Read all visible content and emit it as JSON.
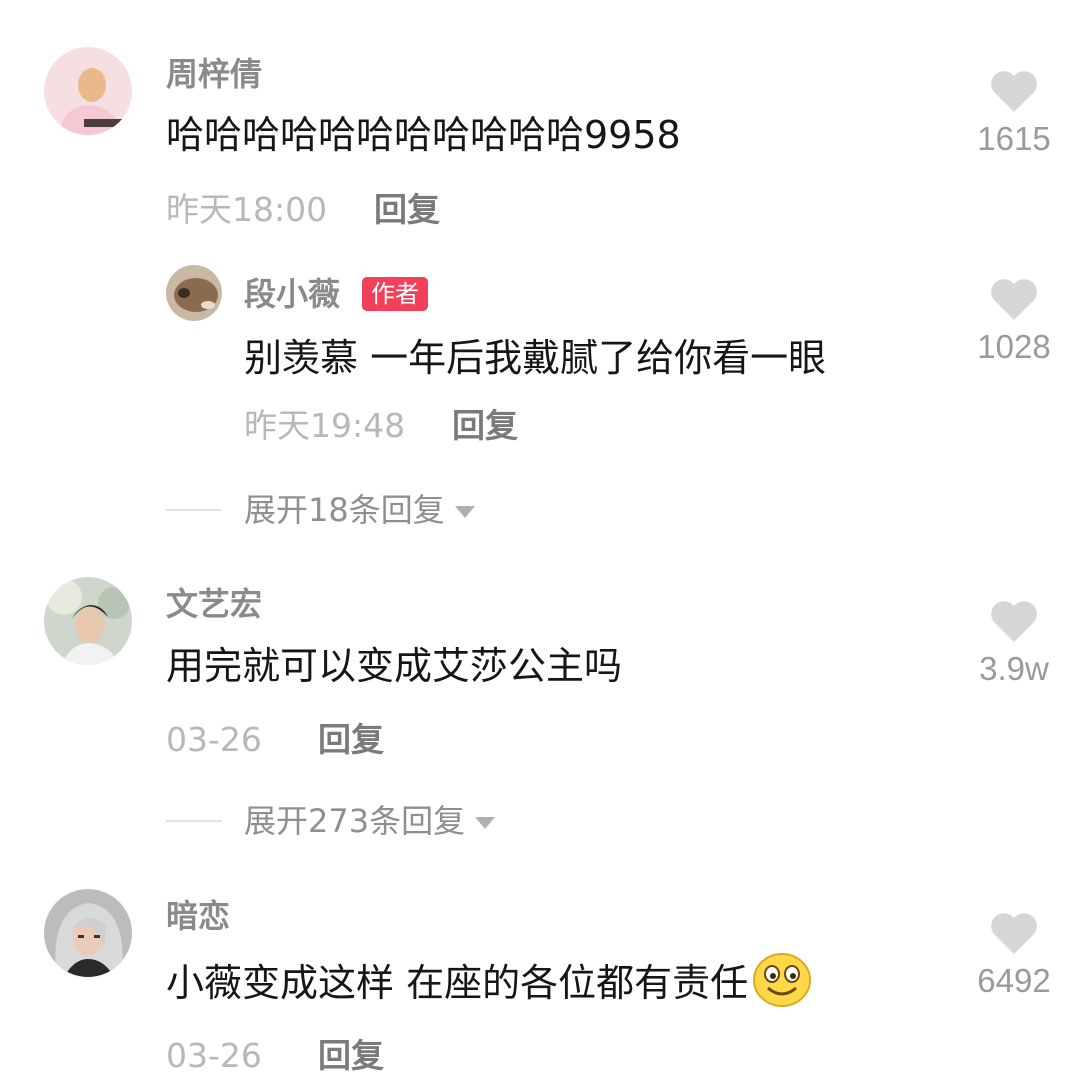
{
  "comments": [
    {
      "user": "周梓倩",
      "text": "哈哈哈哈哈哈哈哈哈哈哈9958",
      "time": "昨天18:00",
      "reply_label": "回复",
      "likes": "1615",
      "reply": {
        "user": "段小薇",
        "badge": "作者",
        "text": "别羡慕 一年后我戴腻了给你看一眼",
        "time": "昨天19:48",
        "reply_label": "回复",
        "likes": "1028"
      },
      "expand_label": "展开18条回复"
    },
    {
      "user": "文艺宏",
      "text": "用完就可以变成艾莎公主吗",
      "time": "03-26",
      "reply_label": "回复",
      "likes": "3.9w",
      "expand_label": "展开273条回复"
    },
    {
      "user": "暗恋",
      "text": "小薇变成这样 在座的各位都有责任",
      "emoji": "smiley-emoji",
      "time": "03-26",
      "reply_label": "回复",
      "likes": "6492"
    }
  ],
  "colors": {
    "background": "#ffffff",
    "username": "#8a8a8a",
    "text": "#161616",
    "timestamp": "#b8b8b8",
    "heart": "#d6d6d6",
    "author_badge": "#f2405a"
  }
}
